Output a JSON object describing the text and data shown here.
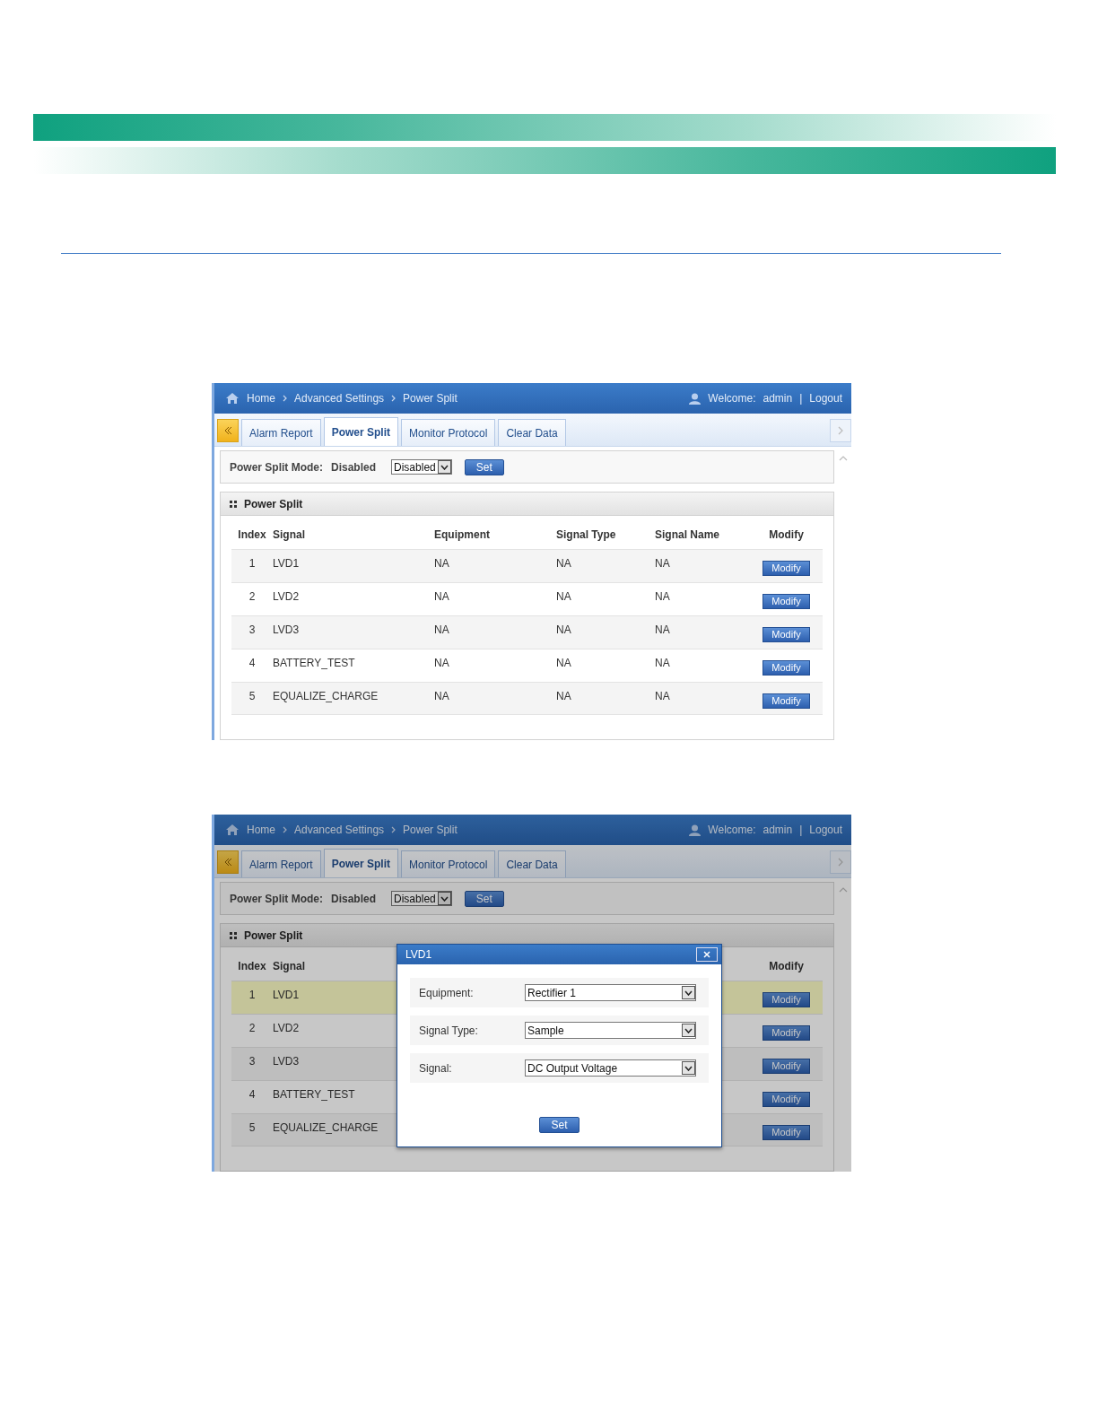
{
  "screenshots": [
    {
      "breadcrumb": [
        "Home",
        "Advanced Settings",
        "Power Split"
      ],
      "welcome": "Welcome:",
      "user": "admin",
      "separator": "|",
      "logout": "Logout",
      "tabs": [
        {
          "label": "Alarm Report",
          "selected": false
        },
        {
          "label": "Power Split",
          "selected": true
        },
        {
          "label": "Monitor Protocol",
          "selected": false
        },
        {
          "label": "Clear Data",
          "selected": false
        }
      ],
      "mode_label": "Power Split Mode:",
      "mode_value": "Disabled",
      "mode_select": "Disabled",
      "set_button": "Set",
      "panel_title": "Power Split",
      "columns": {
        "index": "Index",
        "signal": "Signal",
        "equipment": "Equipment",
        "signal_type": "Signal Type",
        "signal_name": "Signal Name",
        "modify": "Modify"
      },
      "rows": [
        {
          "index": "1",
          "signal": "LVD1",
          "equipment": "NA",
          "signal_type": "NA",
          "signal_name": "NA",
          "modify": "Modify",
          "selected": false
        },
        {
          "index": "2",
          "signal": "LVD2",
          "equipment": "NA",
          "signal_type": "NA",
          "signal_name": "NA",
          "modify": "Modify",
          "selected": false
        },
        {
          "index": "3",
          "signal": "LVD3",
          "equipment": "NA",
          "signal_type": "NA",
          "signal_name": "NA",
          "modify": "Modify",
          "selected": false
        },
        {
          "index": "4",
          "signal": "BATTERY_TEST",
          "equipment": "NA",
          "signal_type": "NA",
          "signal_name": "NA",
          "modify": "Modify",
          "selected": false
        },
        {
          "index": "5",
          "signal": "EQUALIZE_CHARGE",
          "equipment": "NA",
          "signal_type": "NA",
          "signal_name": "NA",
          "modify": "Modify",
          "selected": false
        }
      ]
    },
    {
      "breadcrumb": [
        "Home",
        "Advanced Settings",
        "Power Split"
      ],
      "welcome": "Welcome:",
      "user": "admin",
      "separator": "|",
      "logout": "Logout",
      "tabs": [
        {
          "label": "Alarm Report",
          "selected": false
        },
        {
          "label": "Power Split",
          "selected": true
        },
        {
          "label": "Monitor Protocol",
          "selected": false
        },
        {
          "label": "Clear Data",
          "selected": false
        }
      ],
      "mode_label": "Power Split Mode:",
      "mode_value": "Disabled",
      "mode_select": "Disabled",
      "set_button": "Set",
      "panel_title": "Power Split",
      "columns": {
        "index": "Index",
        "signal": "Signal",
        "modify": "Modify"
      },
      "rows": [
        {
          "index": "1",
          "signal": "LVD1",
          "modify": "Modify",
          "selected": true
        },
        {
          "index": "2",
          "signal": "LVD2",
          "modify": "Modify",
          "selected": false
        },
        {
          "index": "3",
          "signal": "LVD3",
          "modify": "Modify",
          "selected": false
        },
        {
          "index": "4",
          "signal": "BATTERY_TEST",
          "modify": "Modify",
          "selected": false
        },
        {
          "index": "5",
          "signal": "EQUALIZE_CHARGE",
          "modify": "Modify",
          "selected": false
        }
      ],
      "dialog": {
        "title": "LVD1",
        "fields": [
          {
            "label": "Equipment:",
            "value": "Rectifier 1"
          },
          {
            "label": "Signal Type:",
            "value": "Sample"
          },
          {
            "label": "Signal:",
            "value": "DC Output Voltage"
          }
        ],
        "set_button": "Set"
      }
    }
  ]
}
